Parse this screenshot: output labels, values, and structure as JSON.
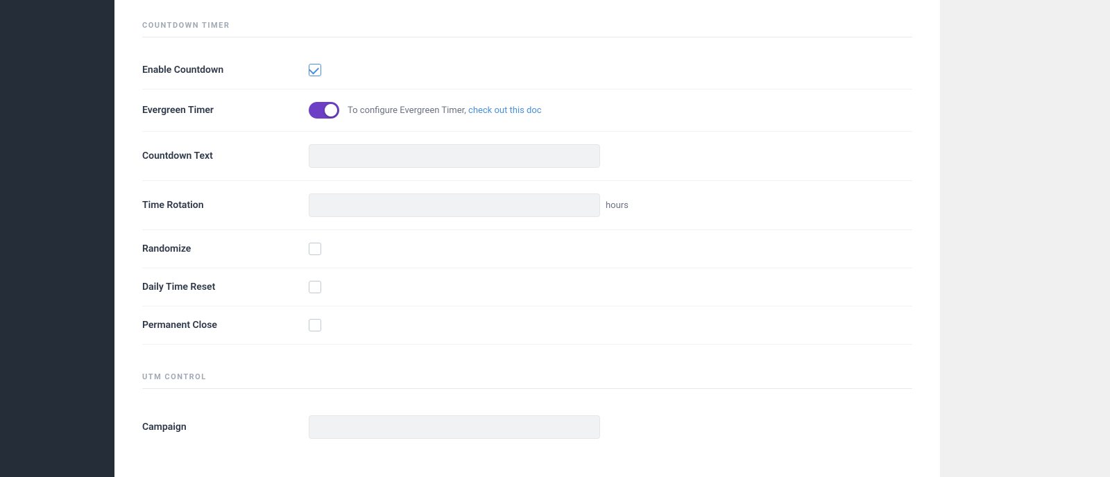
{
  "sidebar": {
    "background": "#252d38"
  },
  "countdown_timer": {
    "section_title": "COUNTDOWN TIMER",
    "enable_countdown": {
      "label": "Enable Countdown",
      "checked": true
    },
    "evergreen_timer": {
      "label": "Evergreen Timer",
      "enabled": true,
      "hint_text": "To configure Evergreen Timer,",
      "link_text": "check out this doc"
    },
    "countdown_text": {
      "label": "Countdown Text",
      "placeholder": "",
      "value": ""
    },
    "time_rotation": {
      "label": "Time Rotation",
      "placeholder": "",
      "value": "",
      "suffix": "hours"
    },
    "randomize": {
      "label": "Randomize",
      "checked": false
    },
    "daily_time_reset": {
      "label": "Daily Time Reset",
      "checked": false
    },
    "permanent_close": {
      "label": "Permanent Close",
      "checked": false
    }
  },
  "utm_control": {
    "section_title": "UTM CONTROL",
    "campaign": {
      "label": "Campaign",
      "placeholder": "",
      "value": ""
    }
  }
}
